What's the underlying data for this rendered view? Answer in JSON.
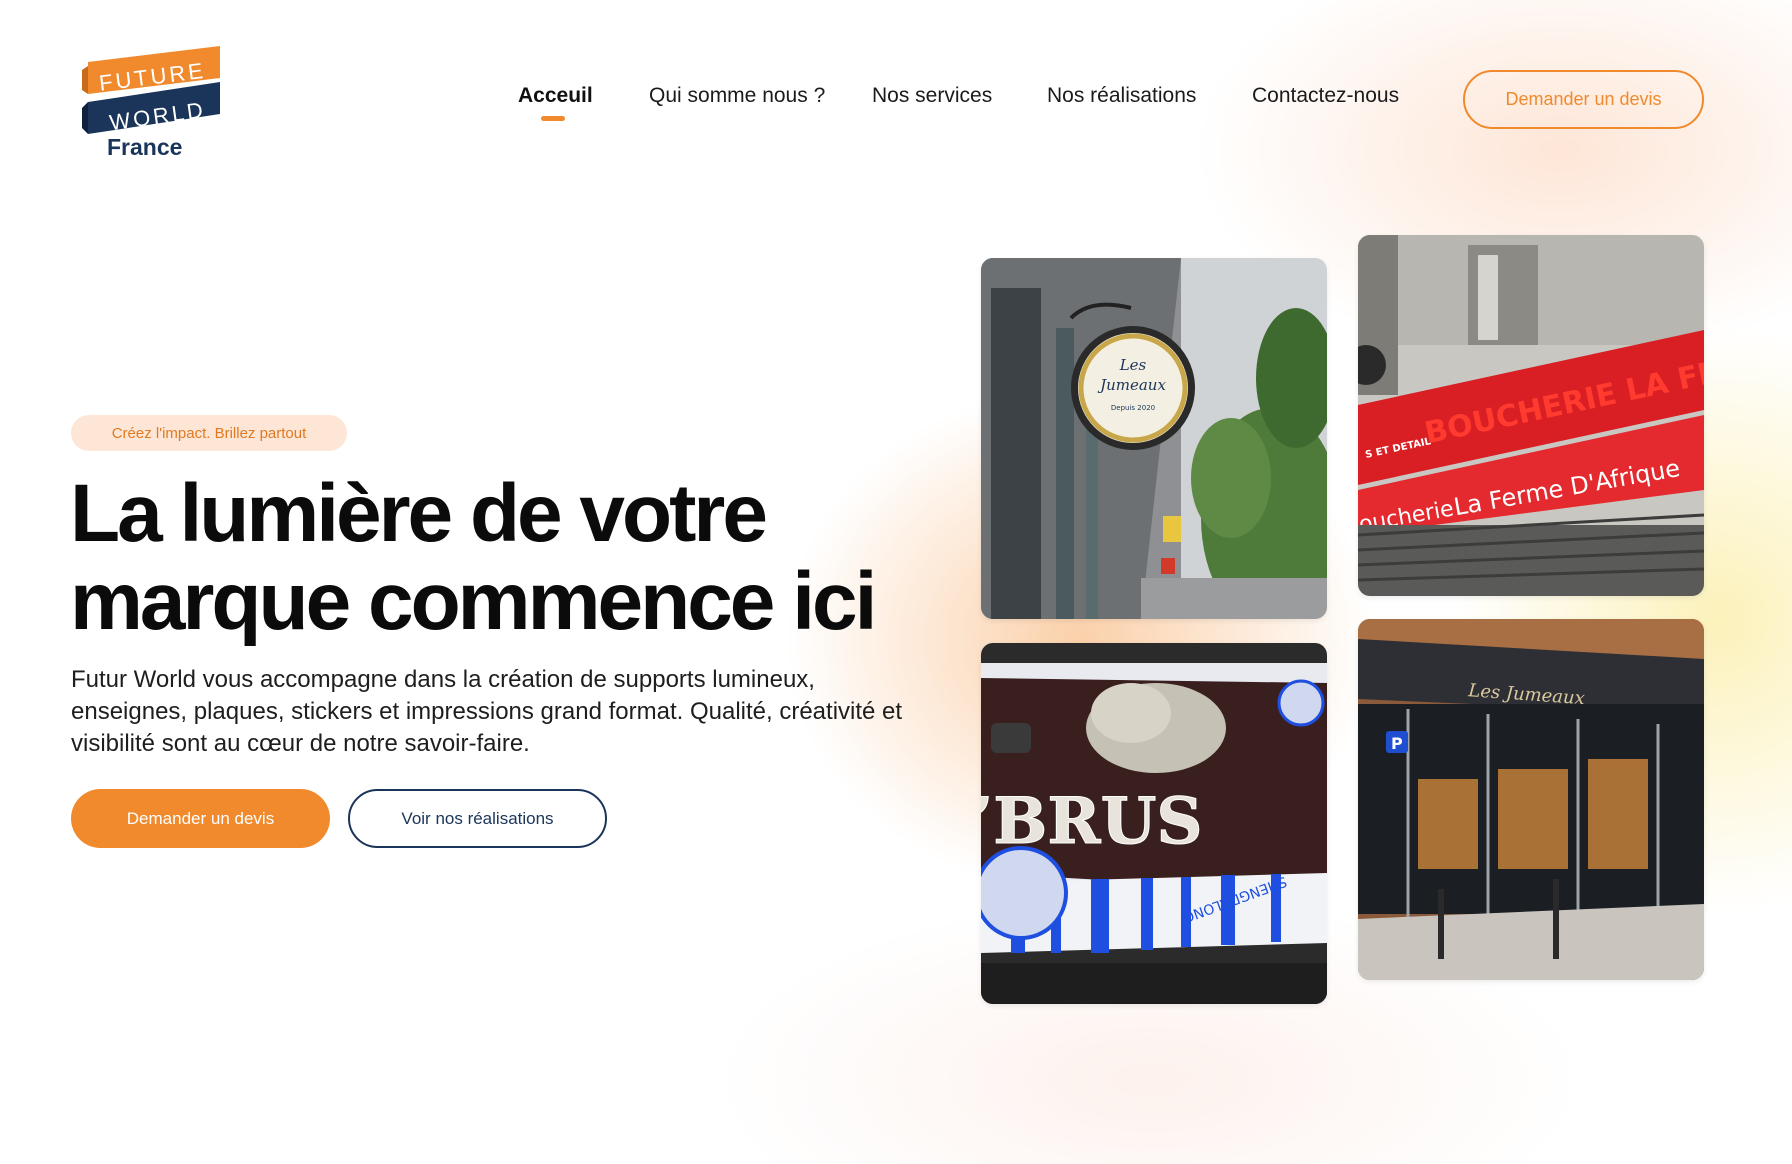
{
  "brand": {
    "logo_line1": "FUTURE",
    "logo_line2": "WORLD",
    "logo_line3": "France",
    "orange": "#f08a2c",
    "navy": "#1a3559"
  },
  "nav": {
    "items": [
      {
        "label": "Acceuil",
        "active": true
      },
      {
        "label": "Qui somme nous ?",
        "active": false
      },
      {
        "label": "Nos services",
        "active": false
      },
      {
        "label": "Nos réalisations",
        "active": false
      },
      {
        "label": "Contactez-nous",
        "active": false
      }
    ],
    "cta_label": "Demander un devis"
  },
  "hero": {
    "tagline": "Créez l'impact. Brillez partout",
    "title_line1": "La lumière de votre",
    "title_line2": "marque commence ici",
    "description": "Futur World vous accompagne dans la création de supports lumineux, enseignes, plaques, stickers et impressions grand format. Qualité, créativité et visibilité sont au cœur de notre savoir-faire.",
    "primary_button": "Demander un devis",
    "secondary_button": "Voir nos réalisations"
  },
  "gallery": {
    "photo1": {
      "sign_text_1": "Les",
      "sign_text_2": "Jumeaux",
      "sign_text_3": "Depuis 2020"
    },
    "photo2": {
      "sign_text_1": "BOUCHERIE LA FERME",
      "sign_text_2": "La Ferme D'Afrique",
      "sign_text_3": "oucherie",
      "sign_text_4": "S ET DETAIL"
    },
    "photo3": {
      "sign_text_1": "’BRUS",
      "sign_text_2": "SHENGDALONG"
    },
    "photo4": {
      "sign_text_1": "Les Jumeaux",
      "sign_text_2": "P"
    }
  }
}
